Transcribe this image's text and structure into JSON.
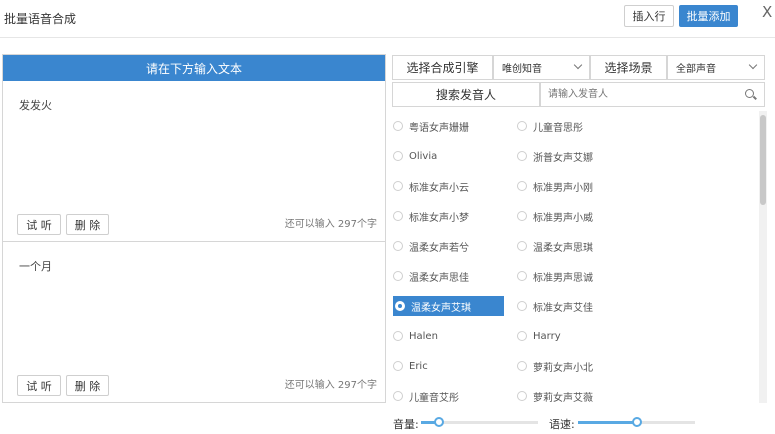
{
  "header": {
    "title": "批量语音合成",
    "insert_label": "插入行",
    "batch_label": "批量添加",
    "close_glyph": "X"
  },
  "left": {
    "head": "请在下方输入文本",
    "blocks": [
      {
        "text": "发发火",
        "listen": "试 听",
        "delete": "删 除",
        "remain": "还可以输入 297个字"
      },
      {
        "text": "一个月",
        "listen": "试 听",
        "delete": "删 除",
        "remain": "还可以输入 297个字"
      }
    ]
  },
  "right": {
    "engine_label": "选择合成引擎",
    "engine_value": "唯创知音",
    "scene_label": "选择场景",
    "scene_value": "全部声音",
    "search_label": "搜索发音人",
    "search_placeholder": "请输入发音人",
    "voices": [
      {
        "left": "粤语女声姗姗",
        "right": "儿童音思彤"
      },
      {
        "left": "Olivia",
        "right": "浙普女声艾娜"
      },
      {
        "left": "标准女声小云",
        "right": "标准男声小刚"
      },
      {
        "left": "标准女声小梦",
        "right": "标准男声小威"
      },
      {
        "left": "温柔女声若兮",
        "right": "温柔女声思琪"
      },
      {
        "left": "温柔女声思佳",
        "right": "标准男声思诚"
      },
      {
        "left": "温柔女声艾琪",
        "right": "标准女声艾佳"
      },
      {
        "left": "Halen",
        "right": "Harry"
      },
      {
        "left": "Eric",
        "right": "萝莉女声小北"
      },
      {
        "left": "儿童音艾彤",
        "right": "萝莉女声艾薇"
      }
    ],
    "selected_voice": "温柔女声艾琪",
    "volume_label": "音量:",
    "volume_level": 0.15,
    "speed_label": "语速:",
    "speed_level": 0.5
  },
  "colors": {
    "accent": "#3a86cf",
    "slider": "#59a9e3"
  }
}
